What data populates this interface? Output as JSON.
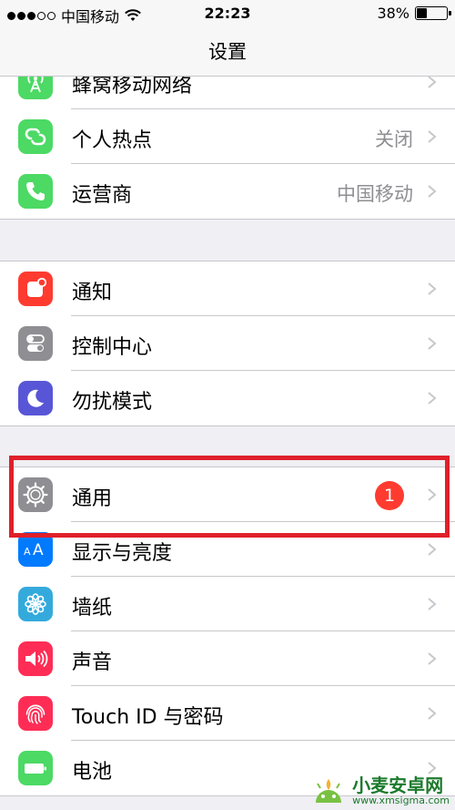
{
  "status_bar": {
    "carrier": "中国移动",
    "time": "22:23",
    "battery_percent": "38%",
    "battery_level": 0.38,
    "signal_filled": 3,
    "signal_total": 5
  },
  "nav": {
    "title": "设置"
  },
  "groups": [
    {
      "rows": [
        {
          "label": "蜂窝移动网络",
          "value": "",
          "icon": "cellular-antenna-icon",
          "color": "#4cd964"
        },
        {
          "label": "个人热点",
          "value": "关闭",
          "icon": "hotspot-link-icon",
          "color": "#4cd964"
        },
        {
          "label": "运营商",
          "value": "中国移动",
          "icon": "phone-icon",
          "color": "#4cd964"
        }
      ]
    },
    {
      "rows": [
        {
          "label": "通知",
          "value": "",
          "icon": "notifications-icon",
          "color": "#ff3b30"
        },
        {
          "label": "控制中心",
          "value": "",
          "icon": "control-center-toggles-icon",
          "color": "#8e8e93"
        },
        {
          "label": "勿扰模式",
          "value": "",
          "icon": "moon-icon",
          "color": "#5856d6"
        }
      ]
    },
    {
      "rows": [
        {
          "label": "通用",
          "value": "",
          "badge": "1",
          "icon": "gear-icon",
          "color": "#8e8e93"
        },
        {
          "label": "显示与亮度",
          "value": "",
          "icon": "text-size-aa-icon",
          "color": "#007aff"
        },
        {
          "label": "墙纸",
          "value": "",
          "icon": "wallpaper-flower-icon",
          "color": "#34aadc"
        },
        {
          "label": "声音",
          "value": "",
          "icon": "speaker-icon",
          "color": "#ff2d55"
        },
        {
          "label": "Touch ID 与密码",
          "value": "",
          "icon": "fingerprint-icon",
          "color": "#ff2d55"
        },
        {
          "label": "电池",
          "value": "",
          "icon": "battery-icon",
          "color": "#4cd964"
        }
      ]
    }
  ],
  "watermark": {
    "title": "小麦安卓网",
    "url": "www.xmsigma.com"
  }
}
